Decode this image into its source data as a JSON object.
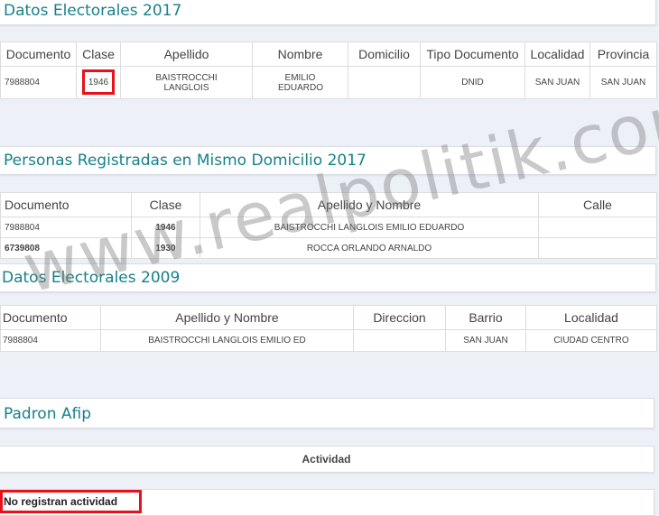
{
  "sections": {
    "datos2017": {
      "title": "Datos Electorales 2017",
      "headers": [
        "Documento",
        "Clase",
        "Apellido",
        "Nombre",
        "Domicilio",
        "Tipo Documento",
        "Localidad",
        "Provincia"
      ],
      "row": {
        "documento": "7988804",
        "clase": "1946",
        "apellido": "BAISTROCCHI LANGLOIS",
        "nombre": "EMILIO EDUARDO",
        "domicilio": "",
        "tipo_documento": "DNID",
        "localidad": "SAN JUAN",
        "provincia": "SAN JUAN"
      }
    },
    "personas2017": {
      "title": "Personas Registradas en Mismo Domicilio 2017",
      "headers": [
        "Documento",
        "Clase",
        "Apellido y Nombre",
        "Calle"
      ],
      "rows": [
        {
          "documento": "7988804",
          "clase": "1946",
          "nombre": "BAISTROCCHI LANGLOIS EMILIO EDUARDO",
          "calle": ""
        },
        {
          "documento": "6739808",
          "clase": "1930",
          "nombre": "ROCCA ORLANDO ARNALDO",
          "calle": ""
        }
      ]
    },
    "datos2009": {
      "title": "Datos Electorales 2009",
      "headers": [
        "Documento",
        "Apellido y Nombre",
        "Direccion",
        "Barrio",
        "Localidad"
      ],
      "row": {
        "documento": "7988804",
        "nombre": "BAISTROCCHI LANGLOIS EMILIO ED",
        "direccion": "",
        "barrio": "SAN JUAN",
        "localidad": "CIUDAD CENTRO"
      }
    },
    "afip": {
      "title": "Padron Afip",
      "actividad_header": "Actividad",
      "no_actividad": "No registran actividad"
    }
  },
  "watermark": "www.realpolitik.com.ar",
  "colors": {
    "accent": "#16818b",
    "highlight": "#e8101a",
    "background": "#eef0f8"
  }
}
